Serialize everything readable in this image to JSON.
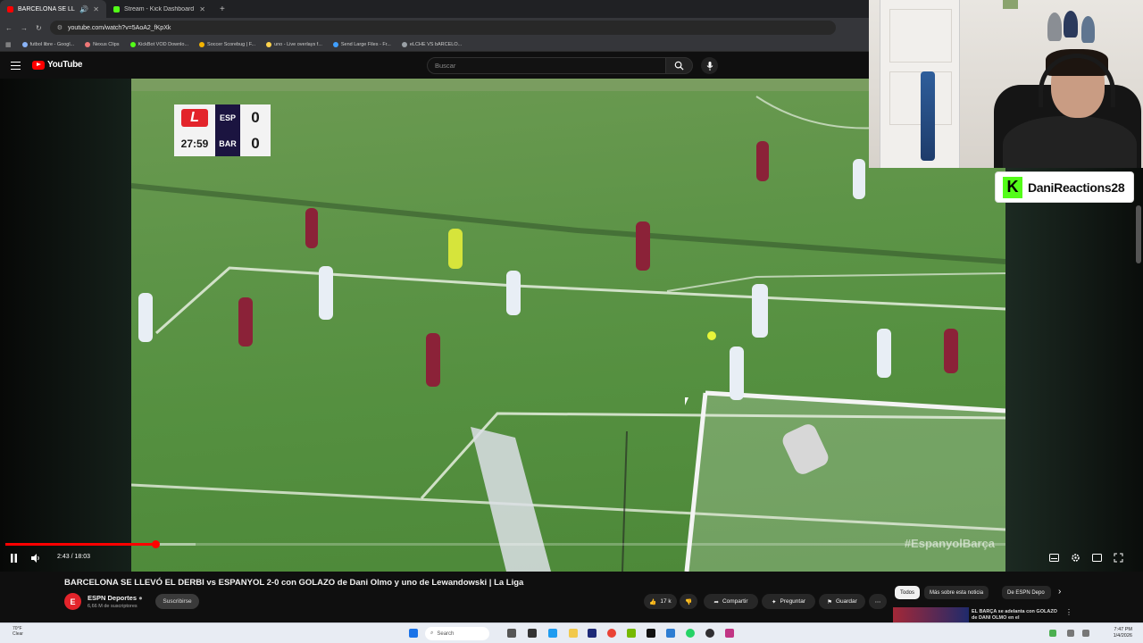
{
  "browser": {
    "tabs": [
      {
        "label": "BARCELONA SE LLEVÓ EL D",
        "color": "#ff0000",
        "active": true
      },
      {
        "label": "Stream - Kick Dashboard",
        "color": "#53fc18",
        "active": false
      }
    ],
    "url": "youtube.com/watch?v=5AoA2_fKpXk",
    "bookmarks": [
      "futbol libre - Googl...",
      "Nexus Clips",
      "KickBot VOD Downlo...",
      "Soccer Scorebug | F...",
      "uno - Live overlays f...",
      "Send Large Files - Fr...",
      "eLCHE VS bARCELO..."
    ]
  },
  "youtube": {
    "logo": "YouTube",
    "search_placeholder": "Buscar"
  },
  "scoreboard": {
    "clock": "27:59",
    "home": "ESP",
    "away": "BAR",
    "home_goals": "0",
    "away_goals": "0"
  },
  "watermark": "#EspanyolBarça",
  "player": {
    "time": "2:43 / 18:03",
    "progress": 0.15,
    "buffered": 0.19
  },
  "video": {
    "title": "BARCELONA SE LLEVÓ EL DERBI vs ESPANYOL 2-0 con GOLAZO de Dani Olmo y uno de Lewandowski | La Liga",
    "channel": "ESPN Deportes",
    "subscribers": "6,66 M de suscriptores",
    "subscribe": "Suscribirse",
    "likes": "17 k",
    "share": "Compartir",
    "ask": "Preguntar",
    "save": "Guardar"
  },
  "chips": [
    "Todos",
    "Más sobre esta noticia",
    "De ESPN Depo"
  ],
  "recommendation": {
    "title": "EL BARÇA se adelanta con GOLAZO de DANI OLMO en el"
  },
  "overlay": {
    "channel": "DaniReactions28",
    "brand_color": "#53fc18"
  },
  "taskbar": {
    "search": "Search",
    "weather_temp": "70°F",
    "weather_desc": "Clear",
    "time": "7:47 PM",
    "date": "1/4/2026"
  }
}
